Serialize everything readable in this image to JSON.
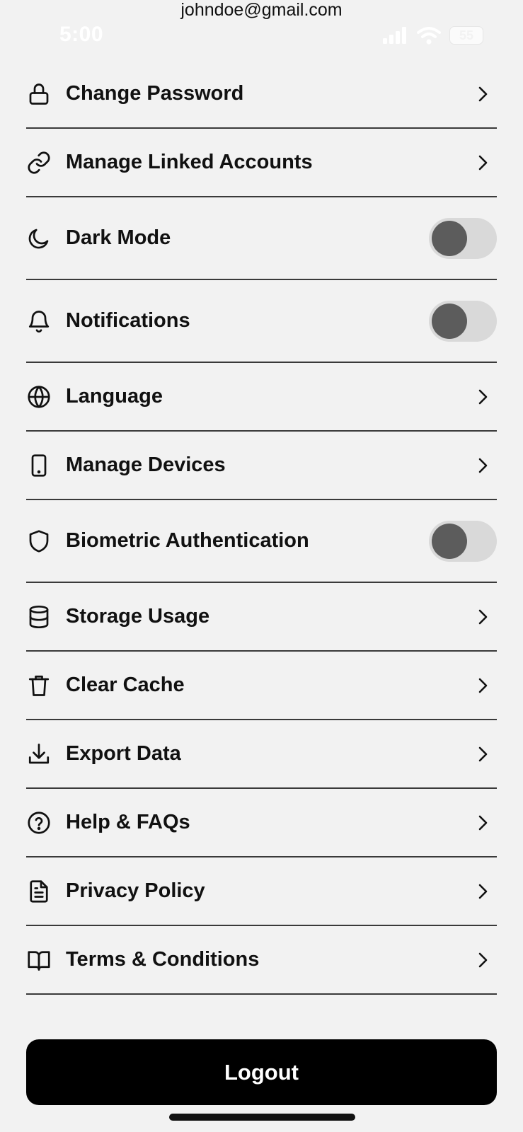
{
  "account": {
    "email": "johndoe@gmail.com"
  },
  "status_bar": {
    "time": "5:00",
    "battery": "55",
    "icons": [
      "signal-icon",
      "wifi-icon",
      "battery-icon"
    ]
  },
  "settings": [
    {
      "label": "Change Password",
      "icon": "lock-icon",
      "type": "nav"
    },
    {
      "label": "Manage Linked Accounts",
      "icon": "link-icon",
      "type": "nav"
    },
    {
      "label": "Dark Mode",
      "icon": "moon-icon",
      "type": "toggle",
      "enabled": false
    },
    {
      "label": "Notifications",
      "icon": "bell-icon",
      "type": "toggle",
      "enabled": false
    },
    {
      "label": "Language",
      "icon": "globe-icon",
      "type": "nav"
    },
    {
      "label": "Manage Devices",
      "icon": "phone-icon",
      "type": "nav"
    },
    {
      "label": "Biometric Authentication",
      "icon": "shield-icon",
      "type": "toggle",
      "enabled": false
    },
    {
      "label": "Storage Usage",
      "icon": "database-icon",
      "type": "nav"
    },
    {
      "label": "Clear Cache",
      "icon": "trash-icon",
      "type": "nav"
    },
    {
      "label": "Export Data",
      "icon": "download-icon",
      "type": "nav"
    },
    {
      "label": "Help & FAQs",
      "icon": "help-circle-icon",
      "type": "nav"
    },
    {
      "label": "Privacy Policy",
      "icon": "document-icon",
      "type": "nav"
    },
    {
      "label": "Terms & Conditions",
      "icon": "book-icon",
      "type": "nav"
    }
  ],
  "logout": {
    "label": "Logout"
  },
  "colors": {
    "background": "#f2f2f2",
    "button": "#000000",
    "toggle_track": "#d9d9d9",
    "toggle_knob": "#5c5c5c"
  }
}
